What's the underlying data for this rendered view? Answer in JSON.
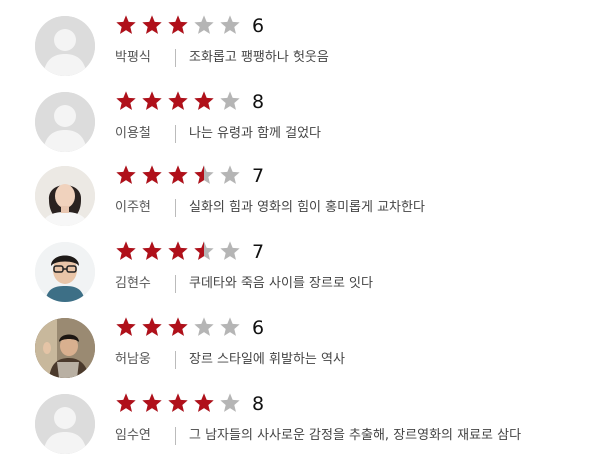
{
  "colors": {
    "star_filled": "#b0101a",
    "star_empty": "#b5b5b5",
    "avatar_bg": "#dcdcdc"
  },
  "reviews": [
    {
      "name": "박평식",
      "score": "6",
      "rating": 3,
      "comment": "조화롭고 팽팽하나 헛웃음",
      "avatar": "default-avatar-icon"
    },
    {
      "name": "이용철",
      "score": "8",
      "rating": 4,
      "comment": "나는 유령과 함께 걸었다",
      "avatar": "default-avatar-icon"
    },
    {
      "name": "이주현",
      "score": "7",
      "rating": 3.5,
      "comment": "실화의 힘과 영화의 힘이 홍미롭게 교차한다",
      "avatar": "reviewer-photo"
    },
    {
      "name": "김현수",
      "score": "7",
      "rating": 3.5,
      "comment": "쿠데타와 죽음 사이를 장르로 잇다",
      "avatar": "reviewer-photo"
    },
    {
      "name": "허남웅",
      "score": "6",
      "rating": 3,
      "comment": "장르 스타일에 휘발하는 역사",
      "avatar": "reviewer-photo"
    },
    {
      "name": "임수연",
      "score": "8",
      "rating": 4,
      "comment": "그 남자들의 사사로운 감정을 추출해, 장르영화의 재료로 삼다",
      "avatar": "default-avatar-icon"
    }
  ]
}
